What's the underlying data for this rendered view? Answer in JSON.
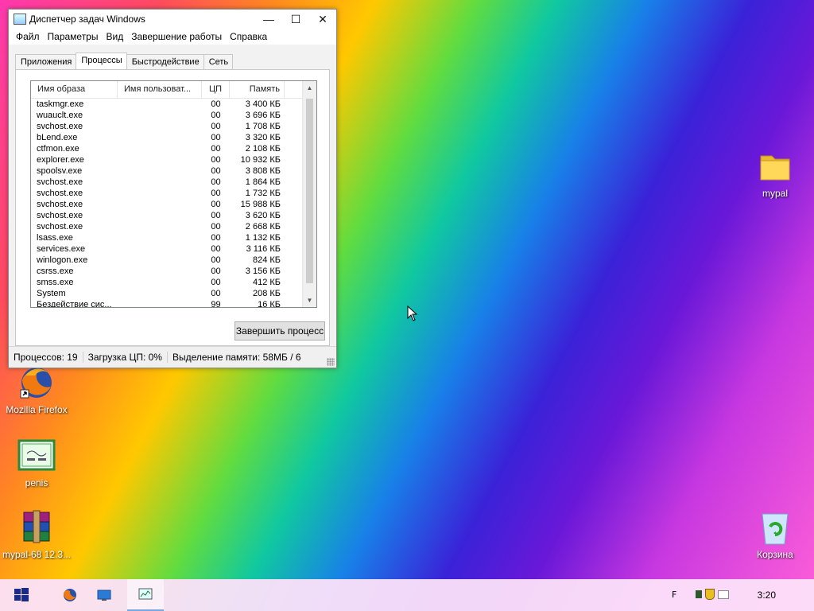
{
  "window": {
    "title": "Диспетчер задач Windows",
    "controls": {
      "minimize": "—",
      "maximize": "☐",
      "close": "✕"
    },
    "menu": [
      "Файл",
      "Параметры",
      "Вид",
      "Завершение работы",
      "Справка"
    ],
    "tabs": [
      "Приложения",
      "Процессы",
      "Быстродействие",
      "Сеть"
    ],
    "active_tab": "Процессы",
    "columns": [
      "Имя образа",
      "Имя пользоват...",
      "ЦП",
      "Память"
    ],
    "processes": [
      {
        "name": "taskmgr.exe",
        "user": "",
        "cpu": "00",
        "mem": "3 400 КБ"
      },
      {
        "name": "wuauclt.exe",
        "user": "",
        "cpu": "00",
        "mem": "3 696 КБ"
      },
      {
        "name": "svchost.exe",
        "user": "",
        "cpu": "00",
        "mem": "1 708 КБ"
      },
      {
        "name": "bLend.exe",
        "user": "",
        "cpu": "00",
        "mem": "3 320 КБ"
      },
      {
        "name": "ctfmon.exe",
        "user": "",
        "cpu": "00",
        "mem": "2 108 КБ"
      },
      {
        "name": "explorer.exe",
        "user": "",
        "cpu": "00",
        "mem": "10 932 КБ"
      },
      {
        "name": "spoolsv.exe",
        "user": "",
        "cpu": "00",
        "mem": "3 808 КБ"
      },
      {
        "name": "svchost.exe",
        "user": "",
        "cpu": "00",
        "mem": "1 864 КБ"
      },
      {
        "name": "svchost.exe",
        "user": "",
        "cpu": "00",
        "mem": "1 732 КБ"
      },
      {
        "name": "svchost.exe",
        "user": "",
        "cpu": "00",
        "mem": "15 988 КБ"
      },
      {
        "name": "svchost.exe",
        "user": "",
        "cpu": "00",
        "mem": "3 620 КБ"
      },
      {
        "name": "svchost.exe",
        "user": "",
        "cpu": "00",
        "mem": "2 668 КБ"
      },
      {
        "name": "lsass.exe",
        "user": "",
        "cpu": "00",
        "mem": "1 132 КБ"
      },
      {
        "name": "services.exe",
        "user": "",
        "cpu": "00",
        "mem": "3 116 КБ"
      },
      {
        "name": "winlogon.exe",
        "user": "",
        "cpu": "00",
        "mem": "824 КБ"
      },
      {
        "name": "csrss.exe",
        "user": "",
        "cpu": "00",
        "mem": "3 156 КБ"
      },
      {
        "name": "smss.exe",
        "user": "",
        "cpu": "00",
        "mem": "412 КБ"
      },
      {
        "name": "System",
        "user": "",
        "cpu": "00",
        "mem": "208 КБ"
      },
      {
        "name": "Бездействие сис...",
        "user": "",
        "cpu": "99",
        "mem": "16 КБ"
      }
    ],
    "end_process_button": "Завершить процесс",
    "status": {
      "processes": "Процессов: 19",
      "cpu": "Загрузка ЦП: 0%",
      "memory": "Выделение памяти: 58МБ / 6"
    }
  },
  "desktop_icons": [
    {
      "label": "mypal",
      "icon": "folder-icon"
    },
    {
      "label": "Mozilla Firefox",
      "icon": "firefox-icon"
    },
    {
      "label": "penis",
      "icon": "certificate-icon"
    },
    {
      "label": "mypal-68 12.3...",
      "icon": "winrar-archive-icon"
    },
    {
      "label": "Корзина",
      "icon": "recycle-bin-icon"
    }
  ],
  "taskbar": {
    "clock": "3:20",
    "buttons": [
      "start-button",
      "firefox-taskbar-button",
      "desktop-taskbar-button",
      "task-manager-taskbar-button"
    ],
    "tray_lang": "F"
  },
  "colors": {
    "accent": "#7aa7e0",
    "taskbar": "#fce2fa",
    "window": "#f2f2f2"
  }
}
